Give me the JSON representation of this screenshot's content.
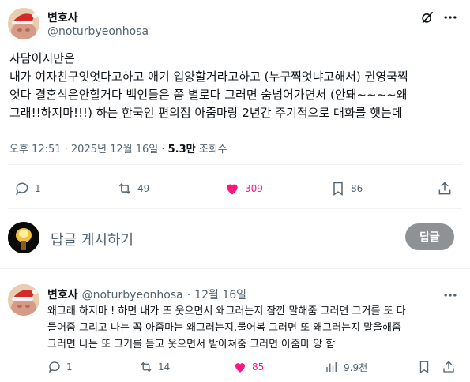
{
  "main_post": {
    "author_name": "변호사",
    "author_handle": "@noturbyeonhosa",
    "lines": [
      "사담이지만은",
      "내가 여자친구잇엇다고하고 애기 입양할거라고하고 (누구찍엇냐고해서) 권영국찍",
      "엇다 결혼식은안할거다 백인들은 쫌 별로다 그러면 숨넘어가면서 (안돼~~~~왜",
      "그래!!하지마!!!) 하는 한국인 편의점 아줌마랑 2년간 주기적으로 대화를 햇는데"
    ],
    "timestamp": "오후 12:51 · 2025년 12월 16일 · ",
    "views_count": "5.3만",
    "views_label": " 조회수",
    "replies": "1",
    "reposts": "49",
    "likes": "309",
    "bookmarks": "86"
  },
  "compose": {
    "placeholder": "답글 게시하기",
    "button_label": "답글"
  },
  "reply_post": {
    "author_name": "변호사",
    "author_handle": "@noturbyeonhosa",
    "dot": "·",
    "date": "12월 16일",
    "lines": [
      "왜그래 하지마 ! 하면 내가 또 웃으면서 왜그러는지 잠깐 말해줌 그러면 그거를 또 다",
      "들어줌 그리고 나는 꼭 아줌마는 왜그러는지.물어봄 그러면 또 왜그러는지 말을해줌",
      "그러면 나는 또 그거를 듣고 웃으면서 받아쳐줌 그러면 아줌마 앙 함"
    ],
    "replies": "1",
    "reposts": "14",
    "likes": "85",
    "views": "9.9천"
  },
  "colors": {
    "like_pink": "#f91880",
    "secondary_text": "#536471",
    "reply_button_bg": "#8e9294"
  },
  "icons": [
    "grok-icon",
    "more-icon",
    "reply-icon",
    "repost-icon",
    "like-icon",
    "bookmark-icon",
    "share-icon",
    "views-icon"
  ]
}
